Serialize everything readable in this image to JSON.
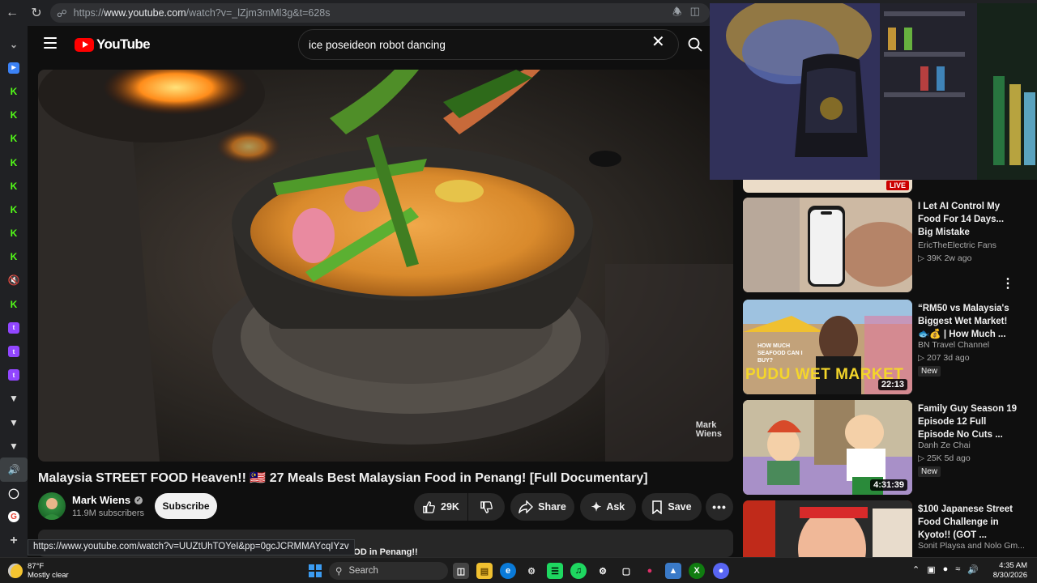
{
  "browser": {
    "url_prefix": "https://",
    "url_host": "www.youtube.com",
    "url_path": "/watch?v=_lZjm3mMl3g&t=628s",
    "status_url": "https://www.youtube.com/watch?v=UUZtUhTOYeI&pp=0gcJCRMMAYcqIYzv"
  },
  "header": {
    "logo_text": "YouTube",
    "search_value": "ice poseideon robot dancing",
    "clear_symbol": "✕"
  },
  "video": {
    "title": "Malaysia STREET FOOD Heaven!! 🇲🇾 27 Meals Best Malaysian Food in Penang! [Full Documentary]",
    "watermark_line1": "Mark",
    "watermark_line2": "Wiens",
    "channel_name": "Mark Wiens",
    "subscribers": "11.9M subscribers",
    "subscribe_label": "Subscribe",
    "likes": "29K",
    "share_label": "Share",
    "ask_label": "Ask",
    "save_label": "Save",
    "description_peek": "FOOD in Penang!!"
  },
  "recommendations": [
    {
      "title": "I Let AI Control My Food For 14 Days... Big Mistake",
      "channel": "EricTheElectric Fans",
      "stats": "▷ 39K  2w ago",
      "duration": "",
      "badge": ""
    },
    {
      "title": "“RM50 vs Malaysia's Biggest Wet Market! 🐟💰 | How Much ...",
      "channel": "BN Travel Channel",
      "stats": "▷ 207  3d ago",
      "duration": "22:13",
      "badge": "New",
      "thumb_text": "PUDU WET MARKET",
      "thumb_subtext": "HOW MUCH SEAFOOD CAN I BUY?"
    },
    {
      "title": "Family Guy Season 19 Episode 12 Full Episode No Cuts ...",
      "channel": "Danh Ze Chai",
      "stats": "▷ 25K  5d ago",
      "duration": "4:31:39",
      "badge": "New"
    },
    {
      "title": "$100 Japanese Street Food Challenge in Kyoto!! (GOT ...",
      "channel": "Sonit Playsa and Nolo Gm...",
      "stats": "",
      "duration": "",
      "badge": ""
    }
  ],
  "live_badge": "LIVE",
  "taskbar": {
    "temp": "87°F",
    "weather": "Mostly clear",
    "search_label": "Search",
    "time": "4:35 AM",
    "date": "8/30/2026"
  },
  "colors": {
    "accent_red": "#ff0000",
    "background": "#0f0f0f",
    "pill": "#272727"
  }
}
